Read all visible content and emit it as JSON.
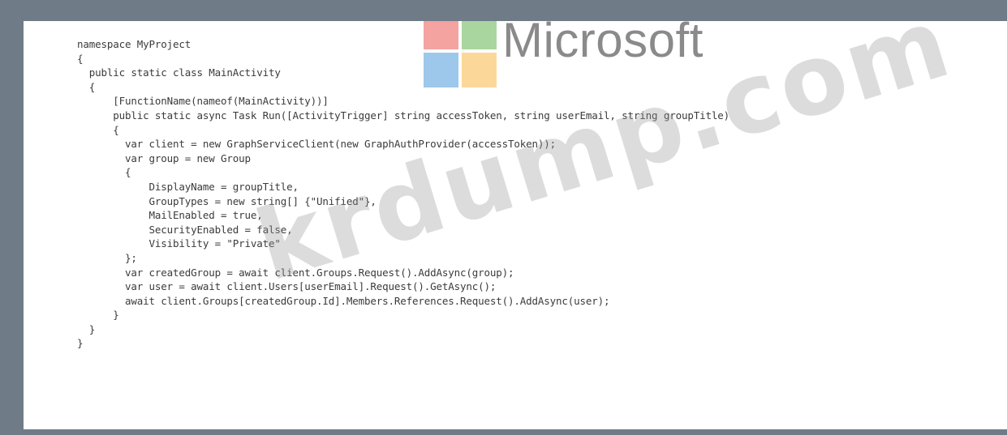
{
  "code_lines": [
    "namespace MyProject",
    "{",
    "  public static class MainActivity",
    "  {",
    "      [FunctionName(nameof(MainActivity))]",
    "      public static async Task Run([ActivityTrigger] string accessToken, string userEmail, string groupTitle)",
    "      {",
    "        var client = new GraphServiceClient(new GraphAuthProvider(accessToken));",
    "        var group = new Group",
    "        {",
    "            DisplayName = groupTitle,",
    "            GroupTypes = new string[] {\"Unified\"},",
    "            MailEnabled = true,",
    "            SecurityEnabled = false,",
    "            Visibility = \"Private\"",
    "        };",
    "        var createdGroup = await client.Groups.Request().AddAsync(group);",
    "        var user = await client.Users[userEmail].Request().GetAsync();",
    "        await client.Groups[createdGroup.Id].Members.References.Request().AddAsync(user);",
    "      }",
    "  }",
    "}"
  ],
  "logo": {
    "wordmark": "Microsoft",
    "colors": {
      "red": "#f4a3a0",
      "green": "#a9d59e",
      "blue": "#9ec7ec",
      "yellow": "#fbd89a"
    }
  },
  "watermark": "krdump.com"
}
